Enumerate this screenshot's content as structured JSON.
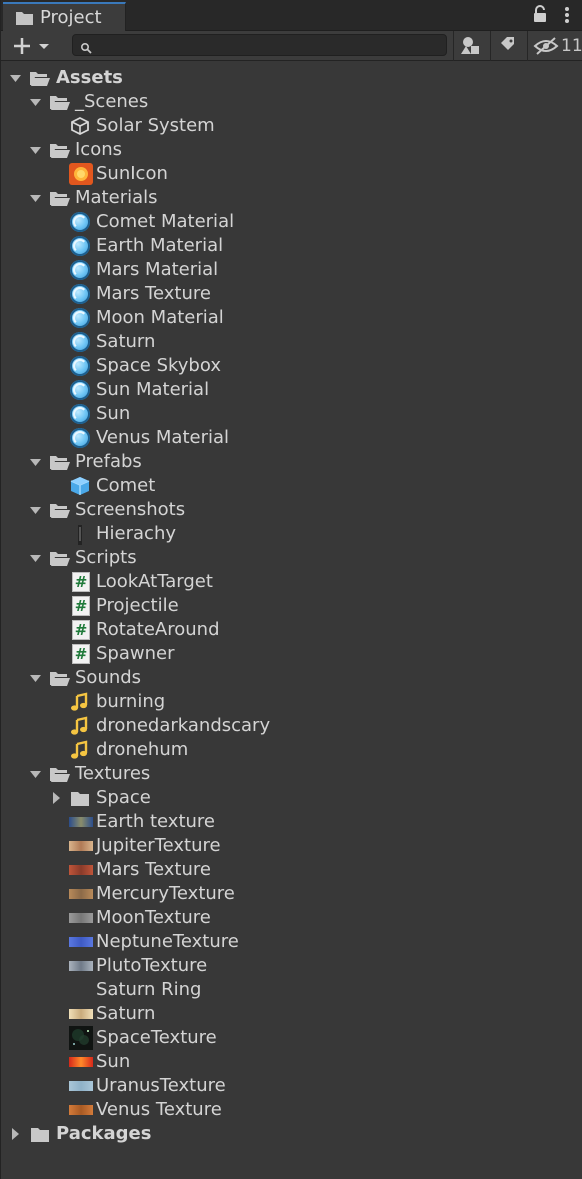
{
  "panel": {
    "title": "Project",
    "hidden_count": "11",
    "search": {
      "value": "",
      "placeholder": ""
    }
  },
  "colors": {
    "background": "#383838",
    "tab_accent": "#3a79bb",
    "material_blue": "#6fc6f5",
    "audio_yellow": "#f5c542",
    "script_green": "#1f7a3a"
  },
  "tree": [
    {
      "label": "Assets",
      "icon": "folder-open-icon",
      "indent": 0,
      "expanded": true,
      "bold": true
    },
    {
      "label": "_Scenes",
      "icon": "folder-open-icon",
      "indent": 1,
      "expanded": true
    },
    {
      "label": "Solar System",
      "icon": "unity-scene-icon",
      "indent": 2
    },
    {
      "label": "Icons",
      "icon": "folder-open-icon",
      "indent": 1,
      "expanded": true
    },
    {
      "label": "SunIcon",
      "icon": "sun-image-icon",
      "indent": 2
    },
    {
      "label": "Materials",
      "icon": "folder-open-icon",
      "indent": 1,
      "expanded": true
    },
    {
      "label": "Comet Material",
      "icon": "material-icon",
      "indent": 2
    },
    {
      "label": "Earth Material",
      "icon": "material-icon",
      "indent": 2
    },
    {
      "label": "Mars Material",
      "icon": "material-icon",
      "indent": 2
    },
    {
      "label": "Mars Texture",
      "icon": "material-icon",
      "indent": 2
    },
    {
      "label": "Moon Material",
      "icon": "material-icon",
      "indent": 2
    },
    {
      "label": "Saturn",
      "icon": "material-icon",
      "indent": 2
    },
    {
      "label": "Space Skybox",
      "icon": "material-icon",
      "indent": 2
    },
    {
      "label": "Sun Material",
      "icon": "material-icon",
      "indent": 2
    },
    {
      "label": "Sun",
      "icon": "material-icon",
      "indent": 2
    },
    {
      "label": "Venus Material",
      "icon": "material-icon",
      "indent": 2
    },
    {
      "label": "Prefabs",
      "icon": "folder-open-icon",
      "indent": 1,
      "expanded": true
    },
    {
      "label": "Comet",
      "icon": "prefab-cube-icon",
      "indent": 2
    },
    {
      "label": "Screenshots",
      "icon": "folder-open-icon",
      "indent": 1,
      "expanded": true
    },
    {
      "label": "Hierachy",
      "icon": "screenshot-thumbnail-icon",
      "indent": 2
    },
    {
      "label": "Scripts",
      "icon": "folder-open-icon",
      "indent": 1,
      "expanded": true
    },
    {
      "label": "LookAtTarget",
      "icon": "csharp-script-icon",
      "indent": 2
    },
    {
      "label": "Projectile",
      "icon": "csharp-script-icon",
      "indent": 2
    },
    {
      "label": "RotateAround",
      "icon": "csharp-script-icon",
      "indent": 2
    },
    {
      "label": "Spawner",
      "icon": "csharp-script-icon",
      "indent": 2
    },
    {
      "label": "Sounds",
      "icon": "folder-open-icon",
      "indent": 1,
      "expanded": true
    },
    {
      "label": "burning",
      "icon": "audio-clip-icon",
      "indent": 2
    },
    {
      "label": "dronedarkandscary",
      "icon": "audio-clip-icon",
      "indent": 2
    },
    {
      "label": "dronehum",
      "icon": "audio-clip-icon",
      "indent": 2
    },
    {
      "label": "Textures",
      "icon": "folder-open-icon",
      "indent": 1,
      "expanded": true
    },
    {
      "label": "Space",
      "icon": "folder-closed-icon",
      "indent": 2,
      "collapsed": true
    },
    {
      "label": "Earth texture",
      "icon": "texture-thumbnail-icon",
      "swatch": [
        "#2b4d8c",
        "#8a8d6a"
      ],
      "indent": 2
    },
    {
      "label": "JupiterTexture",
      "icon": "texture-thumbnail-icon",
      "swatch": [
        "#d9b48c",
        "#b07a56"
      ],
      "indent": 2
    },
    {
      "label": "Mars Texture",
      "icon": "texture-thumbnail-icon",
      "swatch": [
        "#c0553a",
        "#8a3b2a"
      ],
      "indent": 2
    },
    {
      "label": "MercuryTexture",
      "icon": "texture-thumbnail-icon",
      "swatch": [
        "#b88a5a",
        "#8c6a48"
      ],
      "indent": 2
    },
    {
      "label": "MoonTexture",
      "icon": "texture-thumbnail-icon",
      "swatch": [
        "#9a9a9a",
        "#777777"
      ],
      "indent": 2
    },
    {
      "label": "NeptuneTexture",
      "icon": "texture-thumbnail-icon",
      "swatch": [
        "#5a78e0",
        "#3e5ac4"
      ],
      "indent": 2
    },
    {
      "label": "PlutoTexture",
      "icon": "texture-thumbnail-icon",
      "swatch": [
        "#aab3bd",
        "#6f7a88"
      ],
      "indent": 2
    },
    {
      "label": "Saturn Ring",
      "icon": "texture-empty-icon",
      "indent": 2
    },
    {
      "label": "Saturn",
      "icon": "texture-thumbnail-icon",
      "swatch": [
        "#f0dfb8",
        "#c9ab7c"
      ],
      "indent": 2
    },
    {
      "label": "SpaceTexture",
      "icon": "space-thumbnail-icon",
      "indent": 2
    },
    {
      "label": "Sun",
      "icon": "texture-thumbnail-icon",
      "swatch": [
        "#d6281a",
        "#ff8a2a"
      ],
      "indent": 2
    },
    {
      "label": "UranusTexture",
      "icon": "texture-thumbnail-icon",
      "swatch": [
        "#a9c6d8",
        "#8fb1c8"
      ],
      "indent": 2
    },
    {
      "label": "Venus Texture",
      "icon": "texture-thumbnail-icon",
      "swatch": [
        "#d47b3a",
        "#a85a24"
      ],
      "indent": 2
    },
    {
      "label": "Packages",
      "icon": "folder-closed-icon",
      "indent": 0,
      "collapsed": true,
      "bold": true
    }
  ]
}
